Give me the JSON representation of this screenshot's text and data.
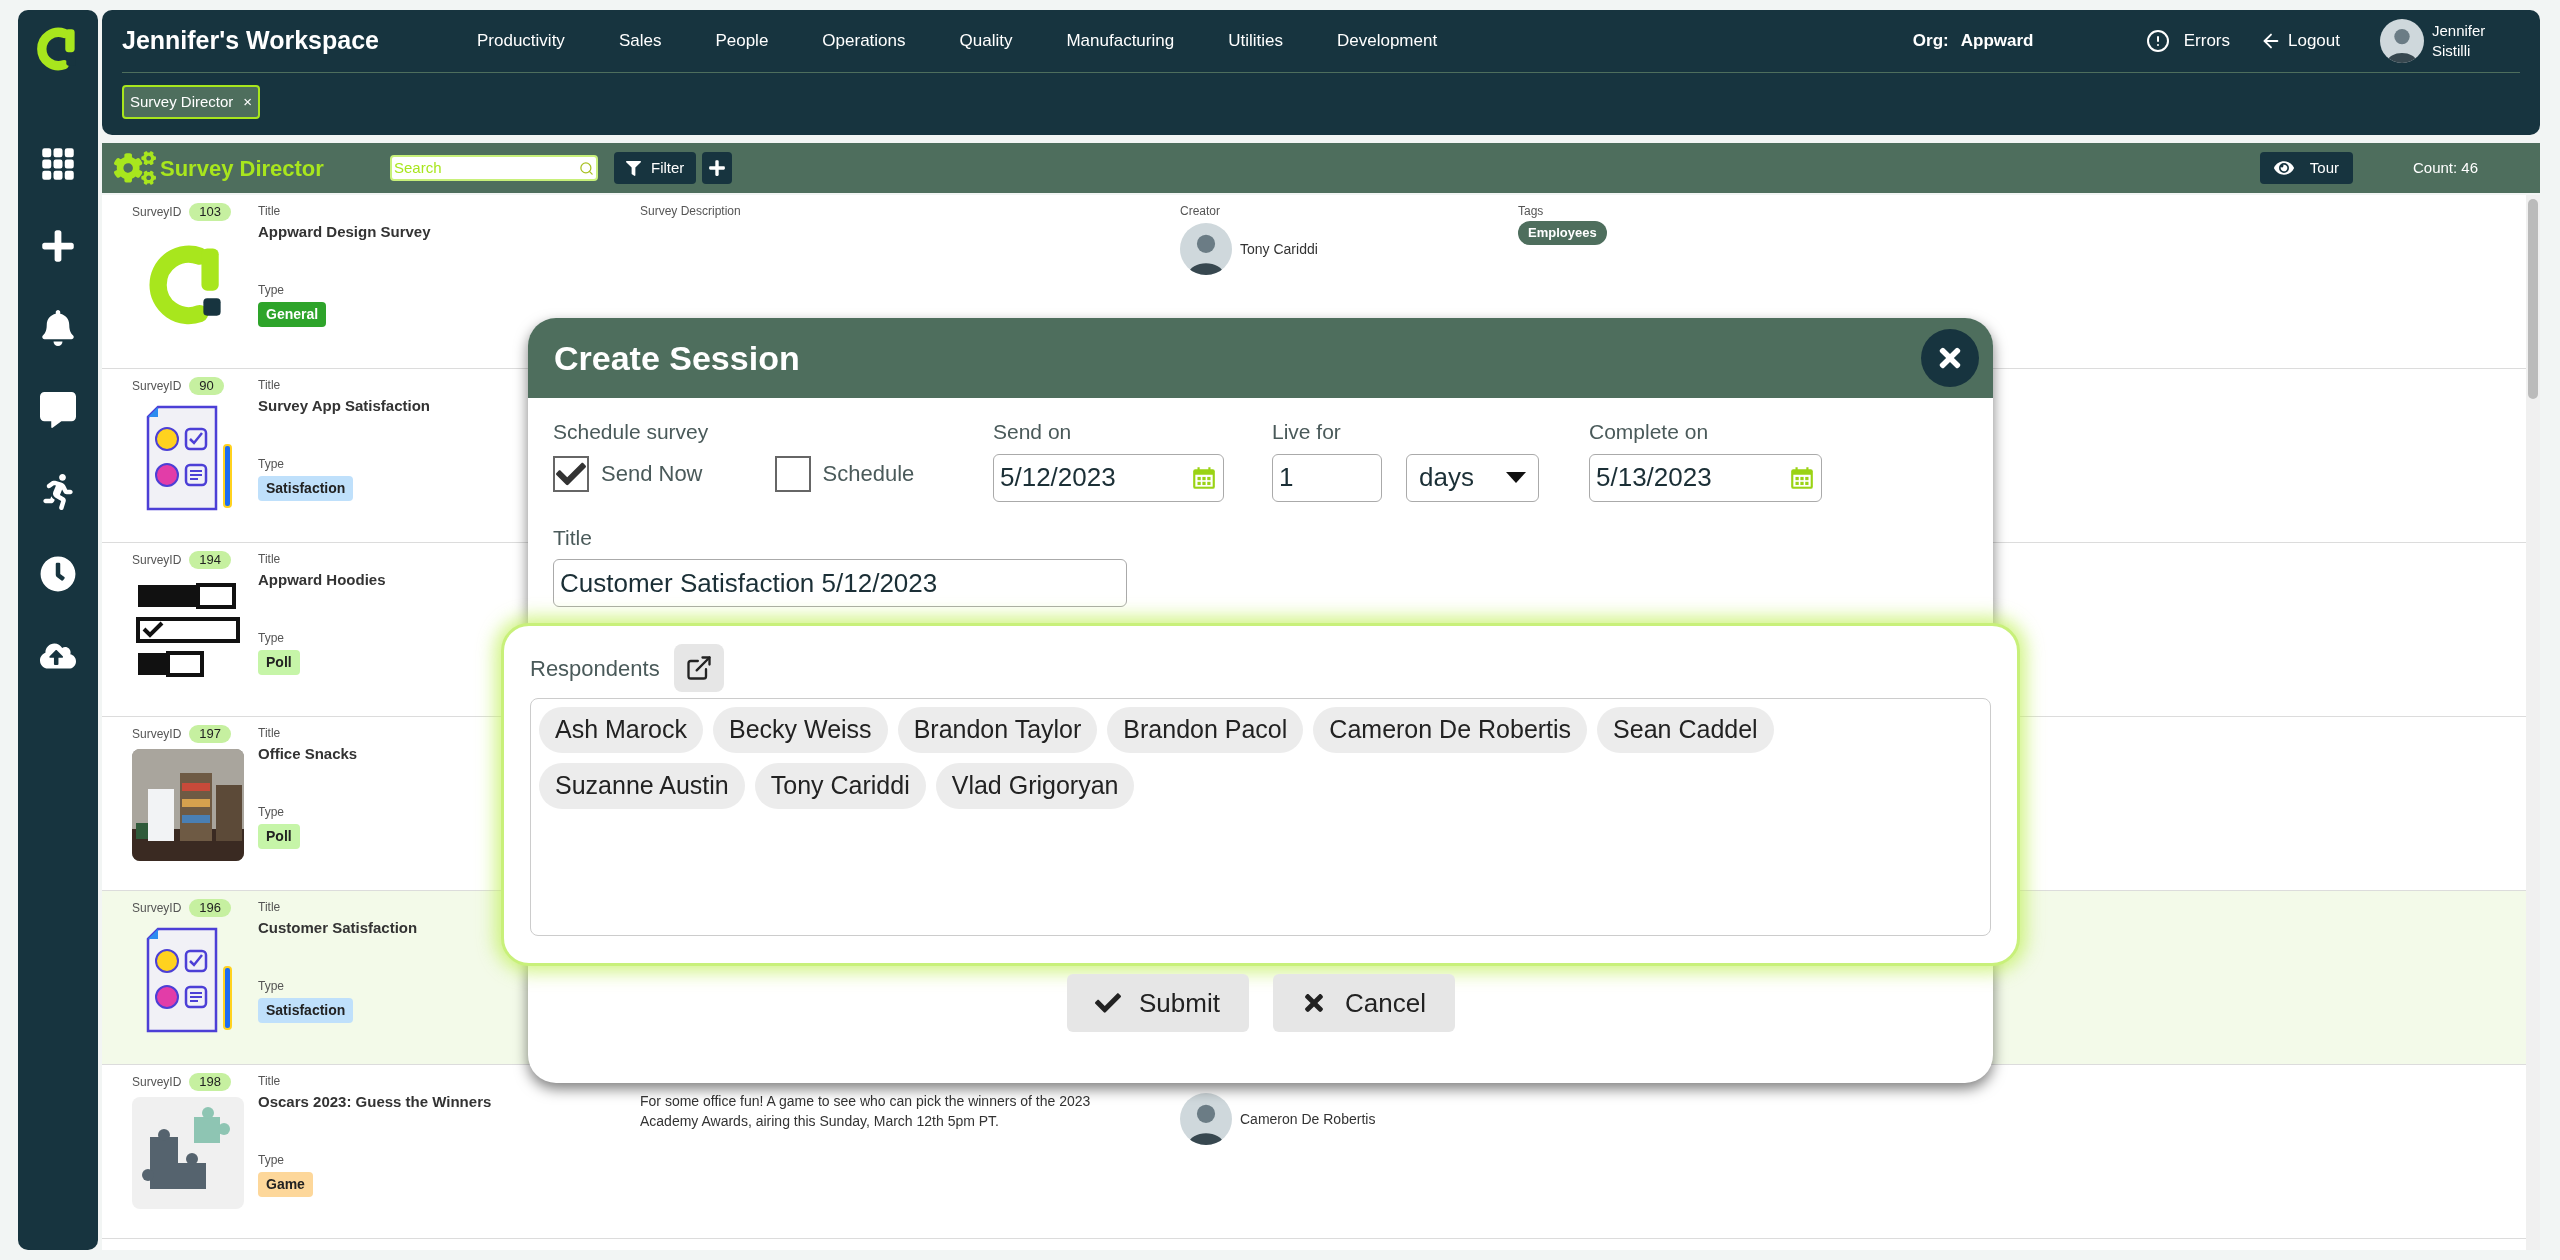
{
  "header": {
    "title": "Jennifer's Workspace",
    "nav": [
      "Productivity",
      "Sales",
      "People",
      "Operations",
      "Quality",
      "Manufacturing",
      "Utilities",
      "Development"
    ],
    "org_label": "Org:",
    "org": "Appward",
    "errors": "Errors",
    "logout": "Logout",
    "user": "Jennifer Sistilli"
  },
  "open_tabs": [
    {
      "label": "Survey Director",
      "close": "×",
      "selected": true
    }
  ],
  "toolbar": {
    "title": "Survey Director",
    "search": {
      "placeholder": "Search"
    },
    "filter": "Filter",
    "tour": "Tour",
    "count": "Count: 46"
  },
  "surveys": [
    {
      "id_label": "SurveyID",
      "id": "103",
      "title_label": "Title",
      "title": "Appward Design Survey",
      "kind": "logo",
      "type_label": "Type",
      "type": {
        "label": "General",
        "color": "#2ea42a"
      },
      "selected": false,
      "details": {
        "description_label": "Survey Description",
        "creator_label": "Creator",
        "creator": "Tony Cariddi",
        "tags_label": "Tags",
        "tags": [
          "Employees"
        ]
      }
    },
    {
      "id_label": "SurveyID",
      "id": "90",
      "title_label": "Title",
      "title": "Survey App Satisfaction",
      "kind": "survey-sheet",
      "type_label": "Type",
      "type": {
        "label": "Satisfaction",
        "color": "#bfe0fb"
      },
      "selected": false
    },
    {
      "id_label": "SurveyID",
      "id": "194",
      "title_label": "Title",
      "title": "Appward Hoodies",
      "kind": "poll-bars",
      "type_label": "Type",
      "type": {
        "label": "Poll",
        "color": "#c6f5a8"
      },
      "selected": false
    },
    {
      "id_label": "SurveyID",
      "id": "197",
      "title_label": "Title",
      "title": "Office Snacks",
      "type_label": "Type",
      "type": {
        "label": "Poll",
        "color": "#c6f5a8"
      },
      "selected": false
    },
    {
      "id_label": "SurveyID",
      "id": "196",
      "title_label": "Title",
      "title": "Customer Satisfaction",
      "kind": "survey-sheet",
      "type_label": "Type",
      "type": {
        "label": "Satisfaction",
        "color": "#bfe0fb"
      },
      "selected": true
    },
    {
      "id_label": "SurveyID",
      "id": "198",
      "title_label": "Title",
      "title": "Oscars 2023: Guess the Winners",
      "kind": "puzzle",
      "type_label": "Type",
      "type": {
        "label": "Game",
        "color": "#fdd79a"
      },
      "selected": false,
      "details": {
        "description": "For some office fun! A game to see who can pick the winners of the 2023 Academy Awards, airing this Sunday, March 12th 5pm PT.",
        "creator": "Cameron De Robertis"
      }
    }
  ],
  "create_session": {
    "title": "Create Session",
    "schedule_label": "Schedule survey",
    "options": [
      {
        "label": "Send Now",
        "checked": true
      },
      {
        "label": "Schedule",
        "checked": false
      }
    ],
    "send_on": {
      "label": "Send on",
      "value": "5/12/2023"
    },
    "live_for": {
      "label": "Live for",
      "value": "1",
      "unit": "days"
    },
    "complete_on": {
      "label": "Complete on",
      "value": "5/13/2023"
    },
    "title_field": {
      "label": "Title",
      "value": "Customer Satisfaction 5/12/2023"
    },
    "respondents": {
      "label": "Respondents",
      "chips": [
        "Ash Marock",
        "Becky Weiss",
        "Brandon Taylor",
        "Brandon Pacol",
        "Cameron De Robertis",
        "Sean Caddel",
        "Suzanne Austin",
        "Tony Cariddi",
        "Vlad Grigoryan"
      ]
    },
    "buttons": [
      {
        "label": "Submit",
        "kind": "submit"
      },
      {
        "label": "Cancel",
        "kind": "cancel"
      }
    ]
  }
}
